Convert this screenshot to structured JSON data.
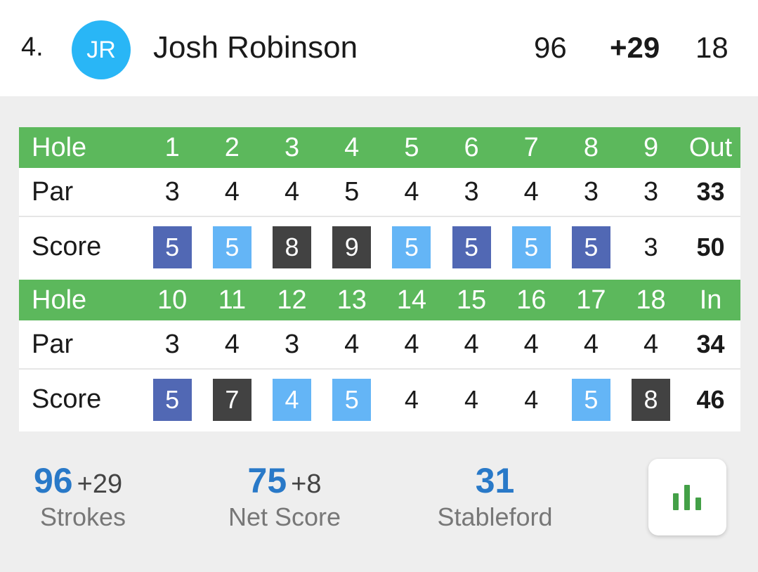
{
  "player": {
    "rank": "4.",
    "initials": "JR",
    "name": "Josh Robinson",
    "strokes": "96",
    "to_par": "+29",
    "thru": "18"
  },
  "front": {
    "hole_label": "Hole",
    "holes": [
      "1",
      "2",
      "3",
      "4",
      "5",
      "6",
      "7",
      "8",
      "9"
    ],
    "total_label": "Out",
    "par_label": "Par",
    "par": [
      "3",
      "4",
      "4",
      "5",
      "4",
      "3",
      "4",
      "3",
      "3"
    ],
    "par_total": "33",
    "score_label": "Score",
    "scores": [
      "5",
      "5",
      "8",
      "9",
      "5",
      "5",
      "5",
      "5",
      "3"
    ],
    "score_total": "50"
  },
  "back": {
    "hole_label": "Hole",
    "holes": [
      "10",
      "11",
      "12",
      "13",
      "14",
      "15",
      "16",
      "17",
      "18"
    ],
    "total_label": "In",
    "par_label": "Par",
    "par": [
      "3",
      "4",
      "3",
      "4",
      "4",
      "4",
      "4",
      "4",
      "4"
    ],
    "par_total": "34",
    "score_label": "Score",
    "scores": [
      "5",
      "7",
      "4",
      "5",
      "4",
      "4",
      "4",
      "5",
      "8"
    ],
    "score_total": "46"
  },
  "summary": {
    "strokes": "96",
    "strokes_diff": "+29",
    "strokes_label": "Strokes",
    "net": "75",
    "net_diff": "+8",
    "net_label": "Net Score",
    "stableford": "31",
    "stableford_label": "Stableford"
  },
  "icons": {
    "stats_button": "bar-chart-icon"
  },
  "colors": {
    "hole_row": "#5cb85c",
    "avatar": "#29b6f6",
    "accent": "#2979c8",
    "double_bogey": "#5168b4",
    "bogey": "#64b5f6",
    "triple_plus": "#424242"
  }
}
